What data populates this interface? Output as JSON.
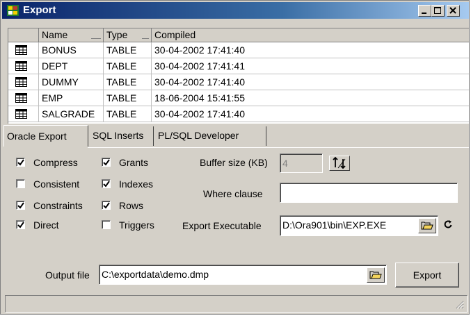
{
  "window": {
    "title": "Export"
  },
  "grid": {
    "columns": [
      "Name",
      "Type",
      "Compiled"
    ],
    "rows": [
      {
        "name": "BONUS",
        "type": "TABLE",
        "compiled": "30-04-2002 17:41:40"
      },
      {
        "name": "DEPT",
        "type": "TABLE",
        "compiled": "30-04-2002 17:41:41"
      },
      {
        "name": "DUMMY",
        "type": "TABLE",
        "compiled": "30-04-2002 17:41:40"
      },
      {
        "name": "EMP",
        "type": "TABLE",
        "compiled": "18-06-2004 15:41:55"
      },
      {
        "name": "SALGRADE",
        "type": "TABLE",
        "compiled": "30-04-2002 17:41:40"
      }
    ]
  },
  "tabs": [
    "Oracle Export",
    "SQL Inserts",
    "PL/SQL Developer"
  ],
  "options": {
    "compress": {
      "label": "Compress",
      "checked": true
    },
    "consistent": {
      "label": "Consistent",
      "checked": false
    },
    "constraints": {
      "label": "Constraints",
      "checked": true
    },
    "direct": {
      "label": "Direct",
      "checked": true
    },
    "grants": {
      "label": "Grants",
      "checked": true
    },
    "indexes": {
      "label": "Indexes",
      "checked": true
    },
    "rows": {
      "label": "Rows",
      "checked": true
    },
    "triggers": {
      "label": "Triggers",
      "checked": false
    }
  },
  "buffer": {
    "label": "Buffer size (KB)",
    "value": "4"
  },
  "where": {
    "label": "Where clause",
    "value": ""
  },
  "executable": {
    "label": "Export Executable",
    "value": "D:\\Ora901\\bin\\EXP.EXE"
  },
  "output": {
    "label": "Output file",
    "value": "C:\\exportdata\\demo.dmp"
  },
  "export_button": "Export",
  "icons": {
    "app": "oracle-app-icon",
    "table": "table-grid-icon",
    "browse": "folder-open-icon",
    "refresh": "refresh-icon"
  }
}
